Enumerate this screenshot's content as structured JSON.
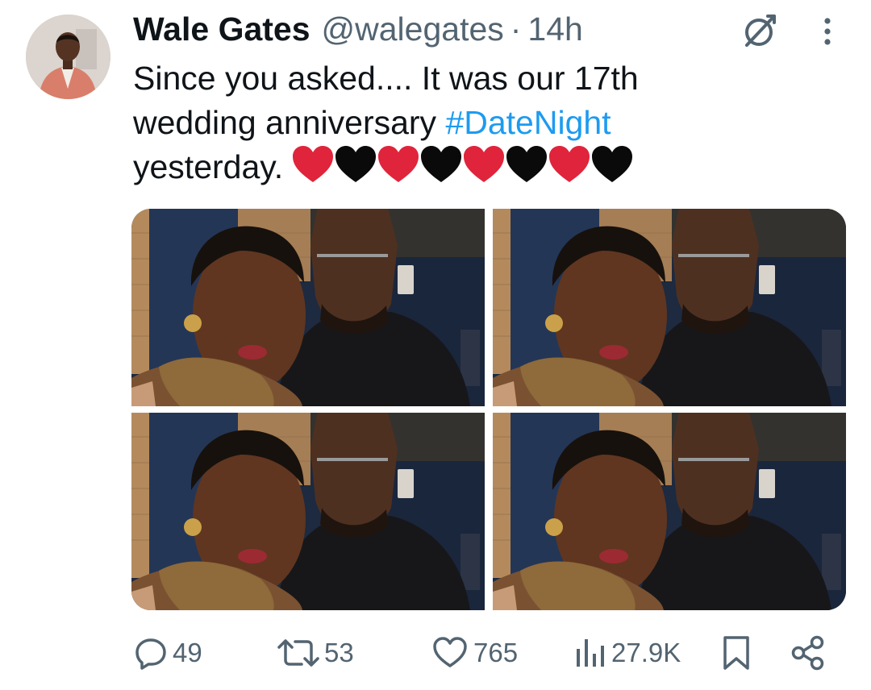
{
  "tweet": {
    "author": {
      "name": "Wale Gates",
      "handle": "@walegates",
      "separator": "·",
      "time": "14h"
    },
    "text": {
      "line1": "Since you asked.... It was our 17th",
      "line2_prefix": "wedding anniversary ",
      "hashtag": "#DateNight",
      "line3": "yesterday.",
      "emoji": [
        "red-heart",
        "black-heart",
        "red-heart",
        "black-heart",
        "red-heart",
        "black-heart",
        "red-heart",
        "black-heart"
      ]
    },
    "media": {
      "photo_count": 4,
      "photos": [
        "photo-1",
        "photo-2",
        "photo-3",
        "photo-4"
      ]
    },
    "actions": {
      "replies": "49",
      "reposts": "53",
      "likes": "765",
      "views": "27.9K"
    },
    "icons": {
      "grok": "grok-slash-icon",
      "more": "more-vertical-icon",
      "reply": "reply-icon",
      "repost": "repost-icon",
      "like": "heart-icon",
      "views": "views-chart-icon",
      "bookmark": "bookmark-icon",
      "share": "share-icon"
    },
    "colors": {
      "text": "#0f1419",
      "secondary": "#536471",
      "link": "#1d9bf0",
      "red_heart": "#e0243b",
      "black_heart": "#0a0a0a"
    }
  }
}
